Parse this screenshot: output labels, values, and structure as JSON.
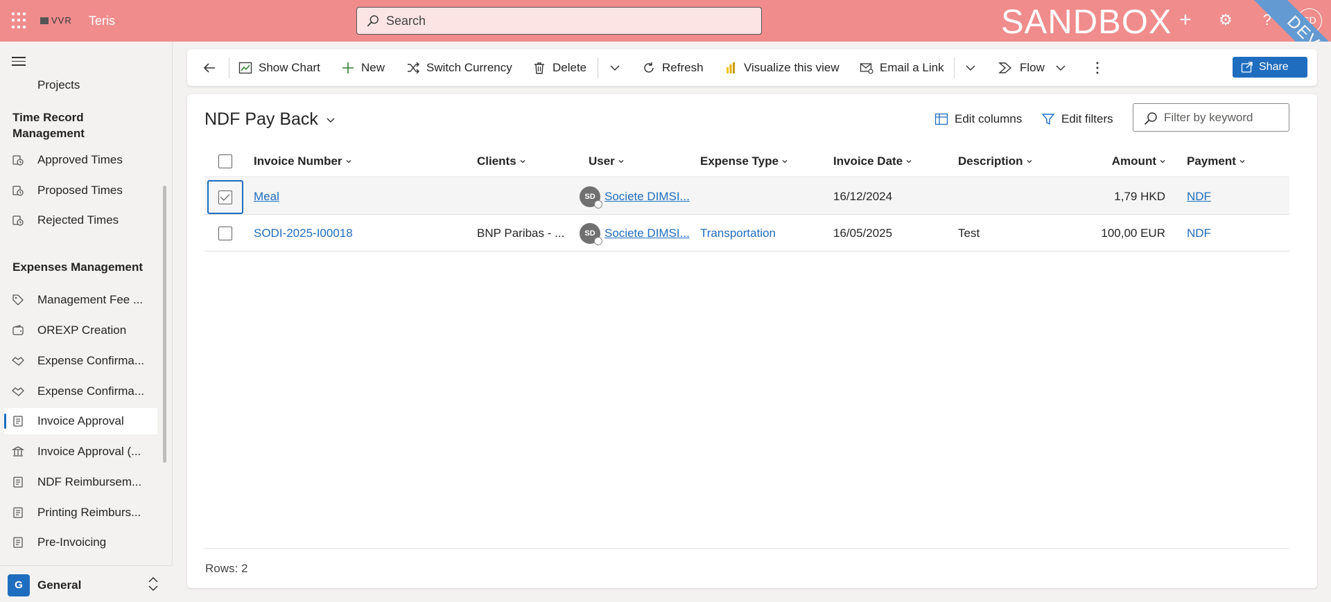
{
  "header": {
    "logo_text": "VVR",
    "app_name": "Teris",
    "search_placeholder": "Search",
    "env_label": "SANDBOX",
    "env_ribbon": "DEV",
    "user_initials": "SD"
  },
  "sidebar": {
    "items": [
      {
        "label": "Projects",
        "icon": "projects-icon"
      },
      {
        "group": "Time Record Management"
      },
      {
        "label": "Approved Times",
        "icon": "time-approved-icon"
      },
      {
        "label": "Proposed Times",
        "icon": "time-proposed-icon"
      },
      {
        "label": "Rejected Times",
        "icon": "time-rejected-icon"
      },
      {
        "group": "Expenses Management"
      },
      {
        "label": "Management Fee ...",
        "icon": "tag-icon"
      },
      {
        "label": "OREXP Creation",
        "icon": "wallet-icon"
      },
      {
        "label": "Expense Confirma...",
        "icon": "handshake-icon"
      },
      {
        "label": "Expense Confirma...",
        "icon": "handshake-icon"
      },
      {
        "label": "Invoice Approval",
        "icon": "document-icon",
        "active": true
      },
      {
        "label": "Invoice Approval (...",
        "icon": "bank-icon"
      },
      {
        "label": "NDF Reimbursem...",
        "icon": "document-icon"
      },
      {
        "label": "Printing Reimburs...",
        "icon": "document-icon"
      },
      {
        "label": "Pre-Invoicing",
        "icon": "document-icon"
      }
    ],
    "area": {
      "badge": "G",
      "label": "General"
    }
  },
  "commandbar": {
    "show_chart": "Show Chart",
    "new": "New",
    "switch_currency": "Switch Currency",
    "delete": "Delete",
    "refresh": "Refresh",
    "visualize": "Visualize this view",
    "email_link": "Email a Link",
    "flow": "Flow",
    "share": "Share"
  },
  "view": {
    "title": "NDF Pay Back",
    "edit_columns": "Edit columns",
    "edit_filters": "Edit filters",
    "filter_placeholder": "Filter by keyword",
    "columns": [
      "Invoice Number",
      "Clients",
      "User",
      "Expense Type",
      "Invoice Date",
      "Description",
      "Amount",
      "Payment"
    ],
    "rows": [
      {
        "invoice_number": "Meal",
        "clients": "",
        "user_initials": "SD",
        "user": "Societe DIMSI...",
        "expense_type": "",
        "invoice_date": "16/12/2024",
        "description": "",
        "amount": "1,79 HKD",
        "payment": "NDF",
        "selected": true
      },
      {
        "invoice_number": "SODI-2025-I00018",
        "clients": "BNP Paribas - ...",
        "user_initials": "SD",
        "user": "Societe DIMSI...",
        "expense_type": "Transportation",
        "invoice_date": "16/05/2025",
        "description": "Test",
        "amount": "100,00 EUR",
        "payment": "NDF",
        "selected": false
      }
    ],
    "rows_count": "Rows: 2"
  },
  "colors": {
    "header_bg": "#f08c8c",
    "accent": "#1f6dbf",
    "ribbon": "#5b9bd5"
  }
}
